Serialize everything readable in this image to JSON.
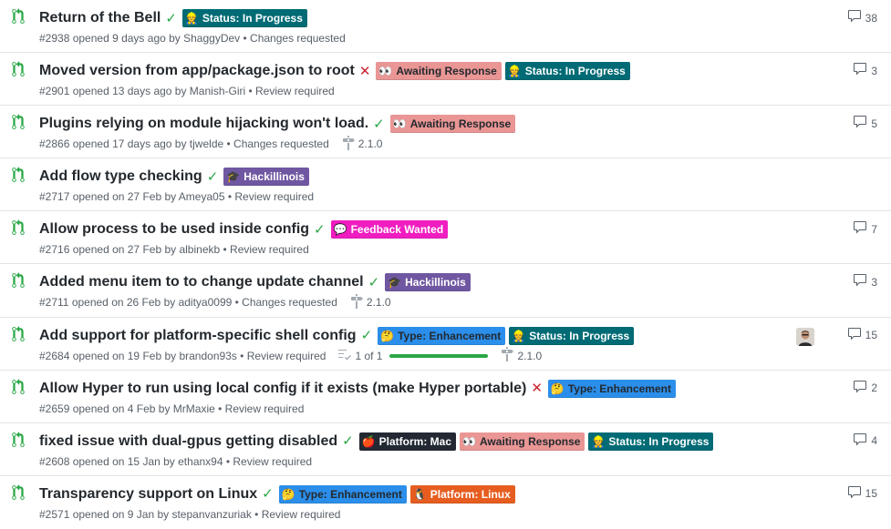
{
  "colors": {
    "pr_open": "#28a745",
    "check": "#28a745",
    "cross": "#cb2431"
  },
  "pull_requests": [
    {
      "title": "Return of the Bell",
      "status": "success",
      "status_glyph": "✓",
      "labels": [
        {
          "text": "Status: In Progress",
          "bg": "#006b75",
          "fg": "#ffffff",
          "icon": "construction-worker-icon",
          "emoji": "👷"
        }
      ],
      "meta": "#2938 opened 9 days ago by ShaggyDev • Changes requested",
      "comments": "38"
    },
    {
      "title": "Moved version from app/package.json to root",
      "status": "failure",
      "status_glyph": "✕",
      "labels": [
        {
          "text": "Awaiting Response",
          "bg": "#e99695",
          "fg": "#24292e",
          "icon": "eyes-icon",
          "emoji": "👀"
        },
        {
          "text": "Status: In Progress",
          "bg": "#006b75",
          "fg": "#ffffff",
          "icon": "construction-worker-icon",
          "emoji": "👷"
        }
      ],
      "meta": "#2901 opened 13 days ago by Manish-Giri • Review required",
      "comments": "3"
    },
    {
      "title": "Plugins relying on module hijacking won't load.",
      "status": "success",
      "status_glyph": "✓",
      "labels": [
        {
          "text": "Awaiting Response",
          "bg": "#e99695",
          "fg": "#24292e",
          "icon": "eyes-icon",
          "emoji": "👀"
        }
      ],
      "meta": "#2866 opened 17 days ago by tjwelde • Changes requested",
      "milestone": "2.1.0",
      "comments": "5"
    },
    {
      "title": "Add flow type checking",
      "status": "success",
      "status_glyph": "✓",
      "labels": [
        {
          "text": "Hackillinois",
          "bg": "#7057a1",
          "fg": "#ffffff",
          "icon": "graduation-cap-icon",
          "emoji": "🎓"
        }
      ],
      "meta": "#2717 opened on 27 Feb by Ameya05 • Review required"
    },
    {
      "title": "Allow process to be used inside config",
      "status": "success",
      "status_glyph": "✓",
      "labels": [
        {
          "text": "Feedback Wanted",
          "bg": "#f01dc1",
          "fg": "#ffffff",
          "icon": "speech-bubble-icon",
          "emoji": "💬"
        }
      ],
      "meta": "#2716 opened on 27 Feb by albinekb • Review required",
      "comments": "7"
    },
    {
      "title": "Added menu item to to change update channel",
      "status": "success",
      "status_glyph": "✓",
      "labels": [
        {
          "text": "Hackillinois",
          "bg": "#7057a1",
          "fg": "#ffffff",
          "icon": "graduation-cap-icon",
          "emoji": "🎓"
        }
      ],
      "meta": "#2711 opened on 26 Feb by aditya0099 • Changes requested",
      "milestone": "2.1.0",
      "comments": "3"
    },
    {
      "title": "Add support for platform-specific shell config",
      "status": "success",
      "status_glyph": "✓",
      "labels": [
        {
          "text": "Type: Enhancement",
          "bg": "#2b8eea",
          "fg": "#24292e",
          "icon": "bulb-icon",
          "emoji": "🤔"
        },
        {
          "text": "Status: In Progress",
          "bg": "#006b75",
          "fg": "#ffffff",
          "icon": "construction-worker-icon",
          "emoji": "👷"
        }
      ],
      "meta": "#2684 opened on 19 Feb by brandon93s • Review required",
      "tasks": "1 of 1",
      "tasks_done": 1,
      "milestone": "2.1.0",
      "assignee": true,
      "comments": "15"
    },
    {
      "title": "Allow Hyper to run using local config if it exists (make Hyper portable)",
      "status": "failure",
      "status_glyph": "✕",
      "labels": [
        {
          "text": "Type: Enhancement",
          "bg": "#2b8eea",
          "fg": "#24292e",
          "icon": "bulb-icon",
          "emoji": "🤔"
        }
      ],
      "meta": "#2659 opened on 4 Feb by MrMaxie • Review required",
      "comments": "2"
    },
    {
      "title": "fixed issue with dual-gpus getting disabled",
      "status": "success",
      "status_glyph": "✓",
      "labels": [
        {
          "text": "Platform: Mac",
          "bg": "#222933",
          "fg": "#ffffff",
          "icon": "apple-icon",
          "emoji": "🍎"
        },
        {
          "text": "Awaiting Response",
          "bg": "#e99695",
          "fg": "#24292e",
          "icon": "eyes-icon",
          "emoji": "👀"
        },
        {
          "text": "Status: In Progress",
          "bg": "#006b75",
          "fg": "#ffffff",
          "icon": "construction-worker-icon",
          "emoji": "👷"
        }
      ],
      "meta": "#2608 opened on 15 Jan by ethanx94 • Review required",
      "comments": "4"
    },
    {
      "title": "Transparency support on Linux",
      "status": "success",
      "status_glyph": "✓",
      "labels": [
        {
          "text": "Type: Enhancement",
          "bg": "#2b8eea",
          "fg": "#24292e",
          "icon": "bulb-icon",
          "emoji": "🤔"
        },
        {
          "text": "Platform: Linux",
          "bg": "#e65d1f",
          "fg": "#ffffff",
          "icon": "penguin-icon",
          "emoji": "🐧"
        }
      ],
      "meta": "#2571 opened on 9 Jan by stepanvanzuriak • Review required",
      "comments": "15"
    }
  ]
}
